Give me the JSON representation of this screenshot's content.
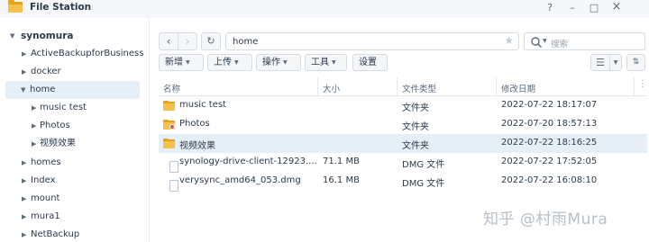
{
  "window": {
    "title": "File Station",
    "help": "?",
    "minimize": "–",
    "maximize": "□",
    "close": "×"
  },
  "sidebar": {
    "root": "synomura",
    "items": [
      {
        "label": "ActiveBackupforBusiness",
        "expanded": false
      },
      {
        "label": "docker",
        "expanded": false
      },
      {
        "label": "home",
        "expanded": true,
        "selected": true
      },
      {
        "label": "music test",
        "expanded": false,
        "child": true
      },
      {
        "label": "Photos",
        "expanded": false,
        "child": true
      },
      {
        "label": "视频效果",
        "expanded": false,
        "child": true
      },
      {
        "label": "homes",
        "expanded": false
      },
      {
        "label": "Index",
        "expanded": false
      },
      {
        "label": "mount",
        "expanded": false
      },
      {
        "label": "mura1",
        "expanded": false
      },
      {
        "label": "NetBackup",
        "expanded": false
      }
    ]
  },
  "navbar": {
    "back": "‹",
    "forward": "›",
    "refresh": "↻",
    "path": "home",
    "search_placeholder": "搜索"
  },
  "toolbar": {
    "create": "新增",
    "upload": "上传",
    "action": "操作",
    "tools": "工具",
    "settings": "设置"
  },
  "table": {
    "columns": [
      "名称",
      "大小",
      "文件类型",
      "修改日期"
    ],
    "more": "⋮",
    "rows": [
      {
        "name": "music test",
        "size": "",
        "type": "文件夹",
        "modified": "2022-07-22 18:17:07",
        "icon": "folder-icon"
      },
      {
        "name": "Photos",
        "size": "",
        "type": "文件夹",
        "modified": "2022-07-20 18:57:13",
        "icon": "shared-folder-icon"
      },
      {
        "name": "视频效果",
        "size": "",
        "type": "文件夹",
        "modified": "2022-07-22 18:16:25",
        "icon": "folder-icon",
        "selected": true
      },
      {
        "name": "synology-drive-client-12923....",
        "size": "71.1 MB",
        "type": "DMG 文件",
        "modified": "2022-07-22 17:52:05",
        "icon": "file-icon"
      },
      {
        "name": "verysync_amd64_053.dmg",
        "size": "16.1 MB",
        "type": "DMG 文件",
        "modified": "2022-07-22 16:08:10",
        "icon": "file-icon"
      }
    ]
  },
  "watermark": "知乎 @村雨Mura"
}
